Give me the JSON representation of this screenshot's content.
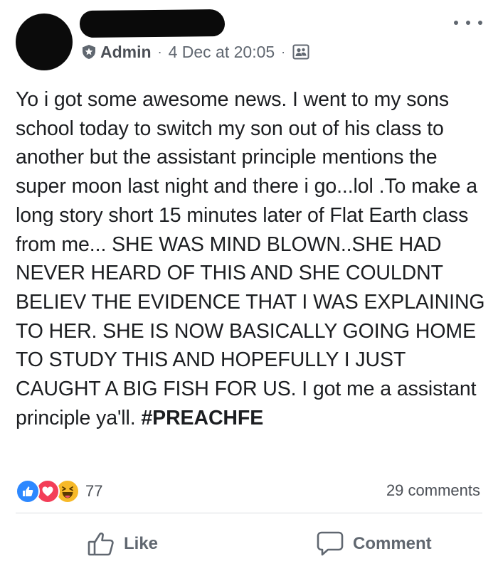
{
  "post": {
    "author_role": "Admin",
    "separator": "·",
    "timestamp": "4 Dec at 20:05",
    "text": "Yo i got some awesome news. I went to my sons school today to switch my son out of his class to another but the assistant principle mentions the super moon last night and there i go...lol .To make a long story short 15 minutes later of Flat Earth class from me... SHE WAS MIND BLOWN..SHE HAD NEVER HEARD OF THIS AND SHE COULDNT BELIEV THE EVIDENCE THAT I WAS EXPLAINING TO HER. SHE IS NOW BASICALLY GOING HOME TO STUDY THIS AND HOPEFULLY I JUST CAUGHT A BIG FISH FOR US. I got me a assistant principle ya'll. ",
    "hashtag": "#PREACHFE"
  },
  "icons": {
    "admin": "shield-star-icon",
    "audience": "group-icon",
    "more": "more-options-icon",
    "reactions": [
      "like-reaction-icon",
      "love-reaction-icon",
      "haha-reaction-icon"
    ],
    "like": "thumbs-up-icon",
    "comment": "comment-bubble-icon"
  },
  "stats": {
    "reaction_count": "77",
    "comment_count": "29 comments"
  },
  "actions": {
    "like_label": "Like",
    "comment_label": "Comment"
  },
  "colors": {
    "like_blue": "#2d88ff",
    "love_red": "#f33e58",
    "haha_yellow": "#f7b928",
    "text_dark": "#1c1e21",
    "text_muted": "#606770"
  }
}
